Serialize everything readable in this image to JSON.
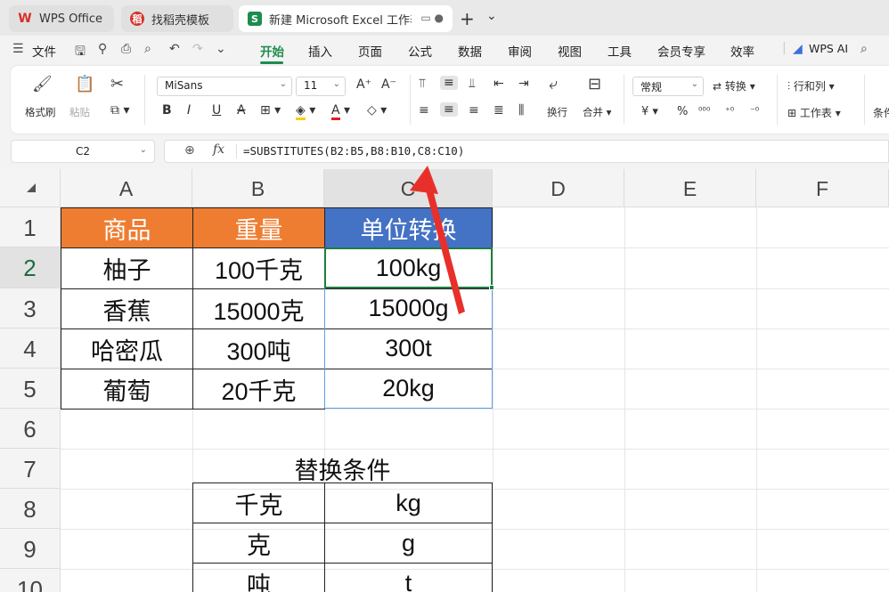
{
  "tabs": [
    {
      "label": "WPS Office",
      "logo": "W"
    },
    {
      "label": "找稻壳模板",
      "logo": "稻"
    },
    {
      "label": "新建 Microsoft Excel 工作表",
      "logo": "S"
    }
  ],
  "menu": {
    "file": "文件",
    "items": [
      "开始",
      "插入",
      "页面",
      "公式",
      "数据",
      "审阅",
      "视图",
      "工具",
      "会员专享",
      "效率"
    ],
    "active": "开始",
    "wps_ai": "WPS AI"
  },
  "ribbon": {
    "format_painter": "格式刷",
    "paste": "粘贴",
    "font_name": "MiSans",
    "font_size": "11",
    "wrap_text": "换行",
    "merge": "合并",
    "number_format": "常规",
    "convert": "转换",
    "rows_cols": "行和列",
    "worksheet": "工作表",
    "conditional": "条件",
    "currency": "¥",
    "percent": "%"
  },
  "formula_bar": {
    "cell_ref": "C2",
    "formula": "=SUBSTITUTES(B2:B5,B8:B10,C8:C10)"
  },
  "columns": [
    "A",
    "B",
    "C",
    "D",
    "E",
    "F"
  ],
  "selected_column": "C",
  "rows": [
    "1",
    "2",
    "3",
    "4",
    "5",
    "6",
    "7",
    "8",
    "9",
    "10"
  ],
  "selected_row": "2",
  "table": {
    "headers": [
      "商品",
      "重量",
      "单位转换"
    ],
    "rows": [
      [
        "柚子",
        "100千克",
        "100kg"
      ],
      [
        "香蕉",
        "15000克",
        "15000g"
      ],
      [
        "哈密瓜",
        "300吨",
        "300t"
      ],
      [
        "葡萄",
        "20千克",
        "20kg"
      ]
    ]
  },
  "replace_table": {
    "title": "替换条件",
    "rows": [
      [
        "千克",
        "kg"
      ],
      [
        "克",
        "g"
      ],
      [
        "吨",
        "t"
      ]
    ]
  },
  "colors": {
    "header_orange": "#ee7d31",
    "header_blue": "#4472c4",
    "accent_green": "#1e8c4e",
    "arrow_red": "#e8302a"
  }
}
